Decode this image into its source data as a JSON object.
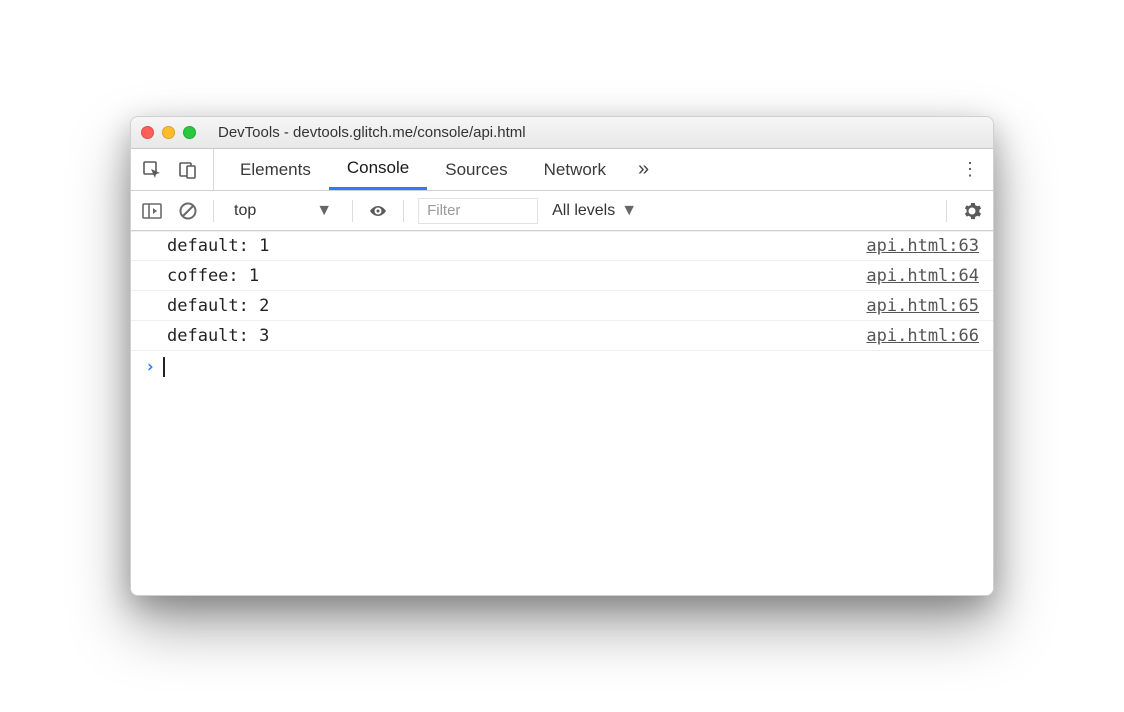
{
  "window": {
    "title": "DevTools - devtools.glitch.me/console/api.html"
  },
  "toolbar": {
    "tabs": [
      {
        "label": "Elements",
        "active": false
      },
      {
        "label": "Console",
        "active": true
      },
      {
        "label": "Sources",
        "active": false
      },
      {
        "label": "Network",
        "active": false
      }
    ],
    "overflow": "»"
  },
  "subbar": {
    "context": "top",
    "filter_placeholder": "Filter",
    "levels": "All levels"
  },
  "console": {
    "logs": [
      {
        "text": "default: 1",
        "source": "api.html:63"
      },
      {
        "text": "coffee: 1",
        "source": "api.html:64"
      },
      {
        "text": "default: 2",
        "source": "api.html:65"
      },
      {
        "text": "default: 3",
        "source": "api.html:66"
      }
    ],
    "prompt": ""
  }
}
